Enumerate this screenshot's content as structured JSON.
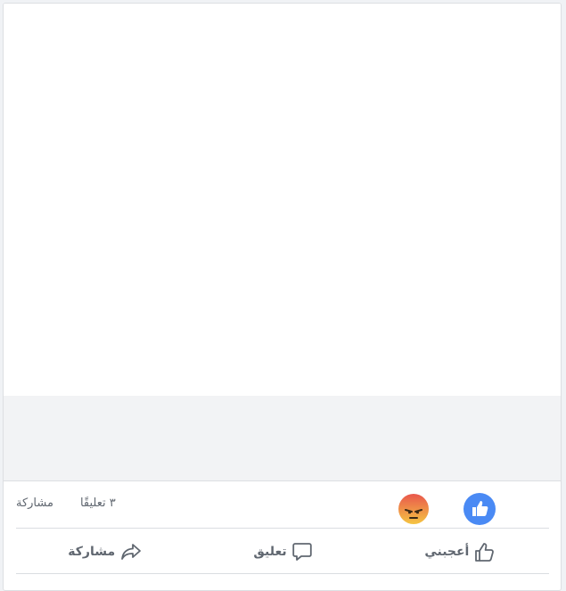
{
  "post": {
    "stats": {
      "comments_label": "٣ تعليقًا",
      "shares_label": "مشاركة"
    },
    "reactions": [
      "like-reaction-icon",
      "angry-reaction-icon"
    ],
    "actions": {
      "like_label": "أعجبني",
      "comment_label": "تعليق",
      "share_label": "مشاركة"
    }
  },
  "colors": {
    "like_blue": "#4a8af4",
    "angry_top": "#e9574d",
    "angry_bottom": "#f5c542",
    "action_text": "#606770",
    "preview_bg": "#f2f3f5"
  }
}
